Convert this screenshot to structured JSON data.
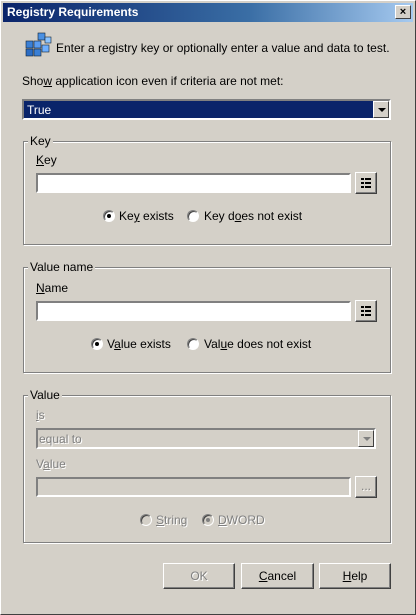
{
  "window": {
    "title": "Registry Requirements",
    "close_label": "×"
  },
  "intro": {
    "text": "Enter a registry key or optionally enter a value and data to test.",
    "icon": "registry-icon"
  },
  "show_icon": {
    "label_pre": "Sho",
    "label_u": "w",
    "label_post": " application icon even if criteria are not met:",
    "selected": "True"
  },
  "key_group": {
    "title": "Key",
    "field_label": "Key",
    "field_label_u": "K",
    "field_label_rest": "ey",
    "value": "",
    "radio_exists": {
      "pre": "Ke",
      "u": "y",
      "post": " exists",
      "checked": true
    },
    "radio_not_exists": {
      "pre": "Key d",
      "u": "o",
      "post": "es not exist",
      "checked": false
    }
  },
  "value_name_group": {
    "title": "Value name",
    "field_label_u": "N",
    "field_label_rest": "ame",
    "value": "",
    "radio_exists": {
      "pre": "V",
      "u": "a",
      "post": "lue exists",
      "checked": true
    },
    "radio_not_exists": {
      "pre": "Val",
      "u": "u",
      "post": "e does not exist",
      "checked": false
    }
  },
  "value_group": {
    "title": "Value",
    "is_label_u": "i",
    "is_label_rest": "s",
    "is_selected": "equal to",
    "value_label_pre": "V",
    "value_label_u": "a",
    "value_label_rest": "lue",
    "browse_label": "...",
    "radio_string": {
      "pre": "",
      "u": "S",
      "post": "tring",
      "checked": false
    },
    "radio_dword": {
      "pre": "",
      "u": "D",
      "post": "WORD",
      "checked": true
    }
  },
  "buttons": {
    "ok": "OK",
    "cancel_u": "C",
    "cancel_rest": "ancel",
    "help_u": "H",
    "help_rest": "elp"
  }
}
